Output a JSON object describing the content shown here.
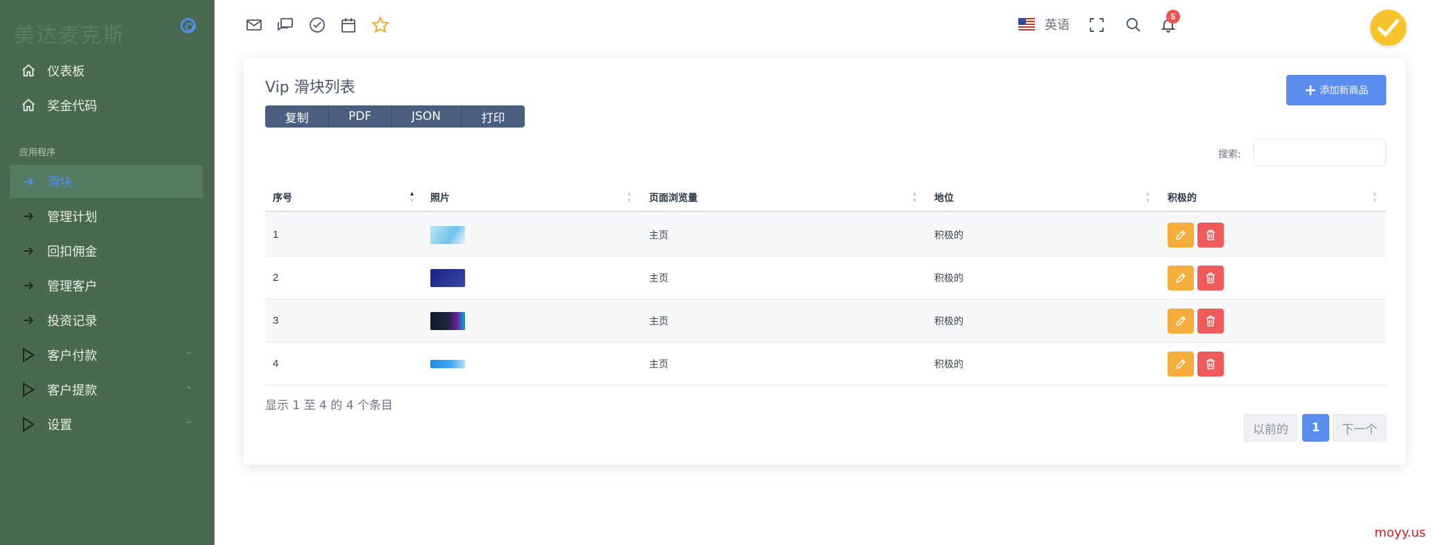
{
  "sidebar": {
    "brand": "美达麦克斯",
    "section_label": "应用程序",
    "items": [
      {
        "label": "仪表板",
        "icon": "home-icon"
      },
      {
        "label": "奖金代码",
        "icon": "home-icon"
      },
      {
        "label": "滑块",
        "icon": "arrow-right-icon",
        "active": true
      },
      {
        "label": "管理计划",
        "icon": "arrow-right-icon"
      },
      {
        "label": "回扣佣金",
        "icon": "arrow-right-icon"
      },
      {
        "label": "管理客户",
        "icon": "arrow-right-icon"
      },
      {
        "label": "投资记录",
        "icon": "arrow-right-icon"
      },
      {
        "label": "客户付款",
        "icon": "play-icon",
        "has_submenu": true
      },
      {
        "label": "客户提款",
        "icon": "play-icon",
        "has_submenu": true
      },
      {
        "label": "设置",
        "icon": "play-icon",
        "has_submenu": true
      }
    ]
  },
  "topbar": {
    "icons": [
      "mail-icon",
      "chat-icon",
      "check-circle-icon",
      "calendar-icon",
      "star-icon"
    ],
    "language": "英语",
    "notification_count": "5"
  },
  "card": {
    "title": "Vip 滑块列表",
    "export_buttons": [
      "复制",
      "PDF",
      "JSON",
      "打印"
    ],
    "add_button": "添加新商品",
    "search_label": "搜索:",
    "search_value": "",
    "columns": [
      "序号",
      "照片",
      "页面浏览量",
      "地位",
      "积极的"
    ],
    "rows": [
      {
        "id": "1",
        "page": "主页",
        "status": "积极的"
      },
      {
        "id": "2",
        "page": "主页",
        "status": "积极的"
      },
      {
        "id": "3",
        "page": "主页",
        "status": "积极的"
      },
      {
        "id": "4",
        "page": "主页",
        "status": "积极的"
      }
    ],
    "info": "显示 1 至 4 的 4 个条目",
    "pagination": {
      "prev": "以前的",
      "current": "1",
      "next": "下一个"
    }
  },
  "watermark": "moyy.us",
  "colors": {
    "sidebar_bg": "#4a6a50",
    "accent": "#5b8def",
    "edit": "#f6ad3c",
    "delete": "#ef5a5a"
  }
}
